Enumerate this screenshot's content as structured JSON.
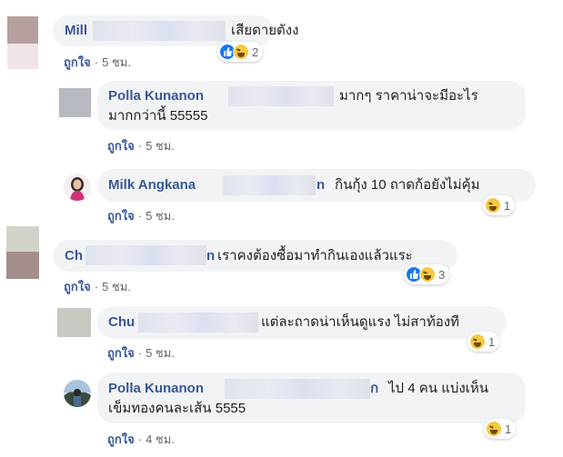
{
  "comments": [
    {
      "name": "Mill",
      "text": "เสียดายตังง",
      "actions": {
        "like": "ถูกใจ",
        "time": "5 ชม."
      },
      "reactions": {
        "icons": [
          "like-icon",
          "haha-icon"
        ],
        "count": "2"
      }
    },
    {
      "name": "Polla Kunanon",
      "text_line1": "มากๆ ราคาน่าจะมีอะไร",
      "text_line2": "มากกว่านี้ 55555",
      "actions": {
        "like": "ถูกใจ",
        "time": "5 ชม."
      }
    },
    {
      "name": "Milk Angkana",
      "name_tail": "n",
      "text": "กินกุ้ง 10 ถาดก้อยังไม่คุ้ม",
      "actions": {
        "like": "ถูกใจ",
        "time": "5 ชม."
      },
      "reactions": {
        "icons": [
          "haha-icon"
        ],
        "count": "1"
      }
    },
    {
      "name": "Ch",
      "name_tail": "n",
      "text": "เราคงต้องซื้อมาทำกินเองแล้วแระ",
      "actions": {
        "like": "ถูกใจ",
        "time": "5 ชม."
      },
      "reactions": {
        "icons": [
          "like-icon",
          "haha-icon"
        ],
        "count": "3"
      }
    },
    {
      "name": "Chu",
      "text": "แต่ละถาดน่าเห็นดูแรง ไม่สาท้องที",
      "actions": {
        "like": "ถูกใจ",
        "time": "5 ชม."
      },
      "reactions": {
        "icons": [
          "haha-icon"
        ],
        "count": "1"
      }
    },
    {
      "name": "Polla Kunanon",
      "name_tail": "ก",
      "text_line1": "ไป 4 คน แบ่งเห็น",
      "text_line2": "เข็มทองคนละเส้น 5555",
      "actions": {
        "like": "ถูกใจ",
        "time": "4 ชม."
      },
      "reactions": {
        "icons": [
          "haha-icon"
        ],
        "count": "1"
      }
    }
  ],
  "colors": {
    "bubble": "#f2f3f5",
    "name": "#385898",
    "meta": "#616770",
    "like": "#1877f2",
    "haha": "#f7c844"
  }
}
